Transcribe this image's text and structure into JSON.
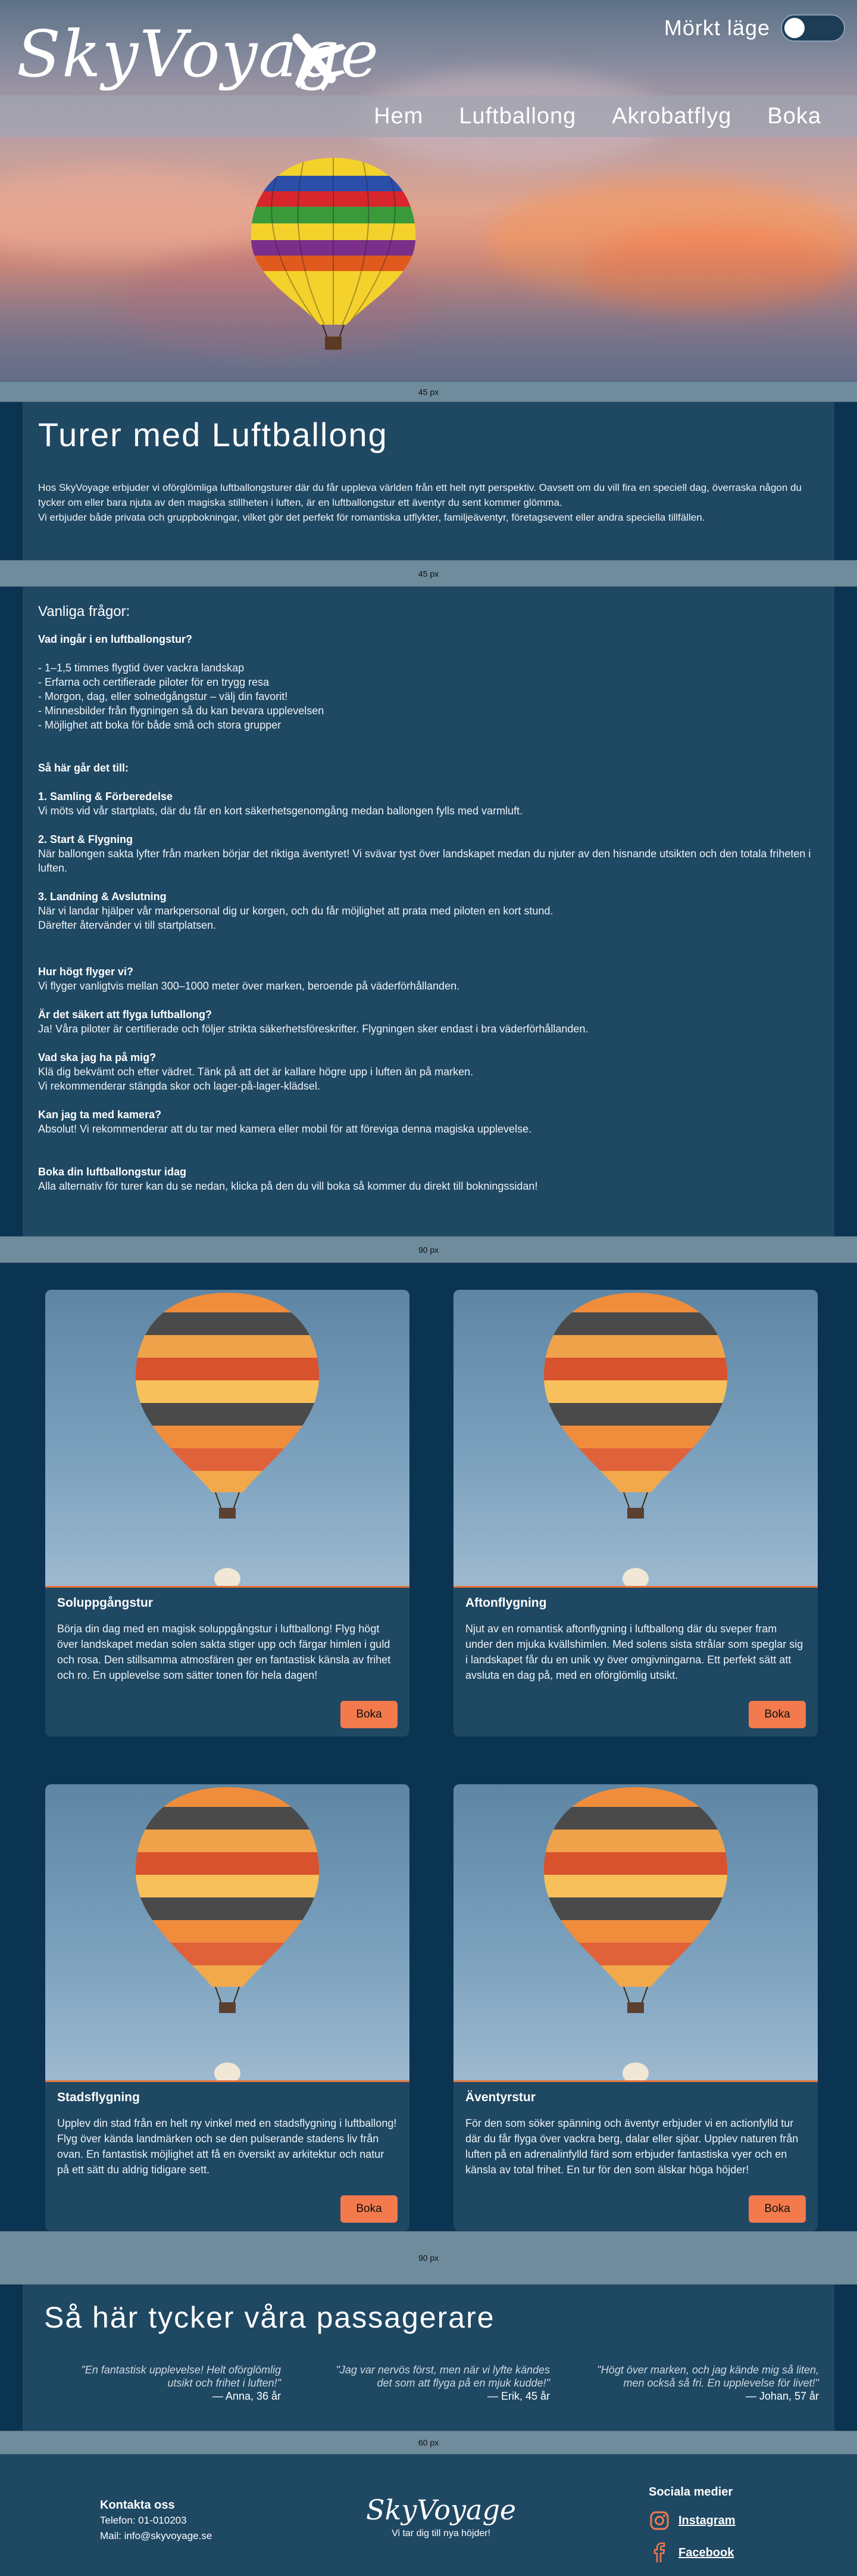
{
  "header": {
    "logo_text": "SkyVoyage",
    "dark_mode_label": "Mörkt läge",
    "dark_mode_on": false
  },
  "nav": {
    "items": [
      {
        "label": "Hem"
      },
      {
        "label": "Luftballong"
      },
      {
        "label": "Akrobatflyg"
      },
      {
        "label": "Boka"
      }
    ]
  },
  "spacers": {
    "s1": "45 px",
    "s2": "45 px",
    "s3": "90 px",
    "s4": "90 px",
    "s5": "60 px"
  },
  "intro": {
    "title": "Turer med Luftballong",
    "p1": "Hos SkyVoyage erbjuder vi oförglömliga luftballongsturer där du får uppleva världen från ett helt nytt perspektiv. Oavsett om du vill fira en speciell dag, överraska någon du tycker om eller bara njuta av den magiska stillheten i luften, är en luftballongstur ett äventyr du sent kommer glömma.",
    "p2": "Vi erbjuder både privata och gruppbokningar, vilket gör det perfekt för romantiska utflykter, familjeäventyr, företagsevent eller andra speciella tillfällen."
  },
  "faq": {
    "label": "Vanliga frågor:",
    "q1": "Vad ingår i en luftballongstur?",
    "list": [
      "- 1–1,5 timmes flygtid över vackra landskap",
      "- Erfarna och certifierade piloter för en trygg resa",
      "- Morgon, dag, eller solnedgångstur – välj din favorit!",
      "- Minnesbilder från flygningen så du kan bevara upplevelsen",
      "- Möjlighet att boka för både små och stora grupper"
    ],
    "how_title": "Så här går det till:",
    "steps": [
      {
        "title": "1. Samling & Förberedelse",
        "text": "Vi möts vid vår startplats, där du får en kort säkerhetsgenomgång medan ballongen fylls med varmluft."
      },
      {
        "title": "2. Start & Flygning",
        "text": "När ballongen sakta lyfter från marken börjar det riktiga äventyret! Vi svävar tyst över landskapet medan du njuter av den hisnande utsikten och den totala friheten i luften."
      },
      {
        "title": "3. Landning & Avslutning",
        "text": "När vi landar hjälper vår markpersonal dig ur korgen, och du får möjlighet att prata med piloten en kort stund.",
        "text2": "Därefter återvänder vi till startplatsen."
      }
    ],
    "qa": [
      {
        "q": "Hur högt flyger vi?",
        "a": "Vi flyger vanligtvis mellan 300–1000 meter över marken, beroende på väderförhållanden."
      },
      {
        "q": "Är det säkert att flyga luftballong?",
        "a": "Ja! Våra piloter är certifierade och följer strikta säkerhetsföreskrifter. Flygningen sker endast i bra väderförhållanden."
      },
      {
        "q": "Vad ska jag ha på mig?",
        "a": "Klä dig bekvämt och efter vädret. Tänk på att det är kallare högre upp i luften än på marken.",
        "a2": "Vi rekommenderar stängda skor och lager-på-lager-klädsel."
      },
      {
        "q": "Kan jag ta med kamera?",
        "a": "Absolut! Vi rekommenderar att du tar med kamera eller mobil för att föreviga denna magiska upplevelse."
      }
    ],
    "book_title": "Boka din luftballongstur idag",
    "book_text": "Alla alternativ för turer kan du se nedan, klicka på den du vill boka så kommer du direkt till bokningssidan!"
  },
  "cards": [
    {
      "title": "Soluppgångstur",
      "desc": "Börja din dag med en magisk soluppgångstur i luftballong! Flyg högt över landskapet medan solen sakta stiger upp och färgar himlen i guld och rosa. Den stillsamma atmosfären ger en fantastisk känsla av frihet och ro. En upplevelse som sätter tonen för hela dagen!",
      "button": "Boka"
    },
    {
      "title": "Aftonflygning",
      "desc": "Njut av en romantisk aftonflygning i luftballong där du sveper fram under den mjuka kvällshimlen. Med solens sista strålar som speglar sig i landskapet får du en unik vy över omgivningarna. Ett perfekt sätt att avsluta en dag på, med en oförglömlig utsikt.",
      "button": "Boka"
    },
    {
      "title": "Stadsflygning",
      "desc": "Upplev din stad från en helt ny vinkel med en stadsflygning i luftballong! Flyg över kända landmärken och se den pulserande stadens liv från ovan. En fantastisk möjlighet att få en översikt av arkitektur och natur på ett sätt du aldrig tidigare sett.",
      "button": "Boka"
    },
    {
      "title": "Äventyrstur",
      "desc": "För den som söker spänning och äventyr erbjuder vi en actionfylld tur där du får flyga över vackra berg, dalar eller sjöar. Upplev naturen från luften på en adrenalinfylld färd som erbjuder fantastiska vyer och en känsla av total frihet. En tur för den som älskar höga höjder!",
      "button": "Boka"
    }
  ],
  "testimonials": {
    "title": "Så här tycker våra passagerare",
    "items": [
      {
        "quote1": "\"En fantastisk upplevelse! Helt oförglömlig",
        "quote2": "utsikt och frihet i luften!\"",
        "author": "— Anna, 36 år"
      },
      {
        "quote1": "\"Jag var nervös först, men när vi lyfte kändes",
        "quote2": "det som att flyga på en mjuk kudde!\"",
        "author": "— Erik, 45 år"
      },
      {
        "quote1": "\"Högt över marken, och jag kände mig så liten,",
        "quote2": "men också så fri. En upplevelse för livet!\"",
        "author": "— Johan, 57 år"
      }
    ]
  },
  "footer": {
    "contact_title": "Kontakta oss",
    "phone": "Telefon: 01-010203",
    "email": "Mail: info@skyvoyage.se",
    "logo_text": "SkyVoyage",
    "tagline": "Vi tar dig till nya höjder!",
    "social_title": "Sociala medier",
    "instagram": "Instagram",
    "facebook": "Facebook"
  }
}
